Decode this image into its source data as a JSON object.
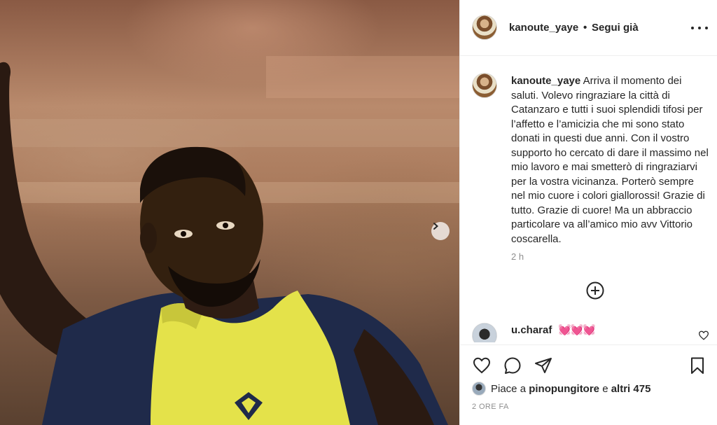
{
  "post": {
    "username": "kanoute_yaye",
    "follow_separator": "•",
    "follow_status": "Segui già",
    "caption": "Arriva il momento dei saluti. Volevo ringraziare la città di Catanzaro e tutti i suoi splendidi tifosi per l’affetto e l’amicizia che mi sono stato donati in questi due anni. Con il vostro supporto ho cercato di dare il massimo nel mio lavoro e mai smetterò di ringraziarvi per la vostra vicinanza. Porterò sempre nel mio cuore i colori giallorossi! Grazie di tutto. Grazie di cuore! Ma un abbraccio particolare va all’amico mio avv Vittorio coscarella.",
    "caption_time": "2 h",
    "timestamp": "2 ORE FA"
  },
  "comments": [
    {
      "username": "u.charaf",
      "text": "💓💓💓"
    }
  ],
  "likes": {
    "prefix": "Piace a",
    "first_user": "pinopungitore",
    "joiner": "e",
    "others": "altri 475"
  },
  "icons": {
    "more": "more-options-icon",
    "next": "chevron-right-icon",
    "load_more": "plus-circle-icon",
    "like": "heart-icon",
    "comment": "comment-icon",
    "share": "share-icon",
    "save": "bookmark-icon"
  },
  "colors": {
    "text": "#262626",
    "muted": "#8e8e8e",
    "border": "#efefef",
    "vest": "#e4e24a",
    "shirt": "#1f2a4a"
  }
}
